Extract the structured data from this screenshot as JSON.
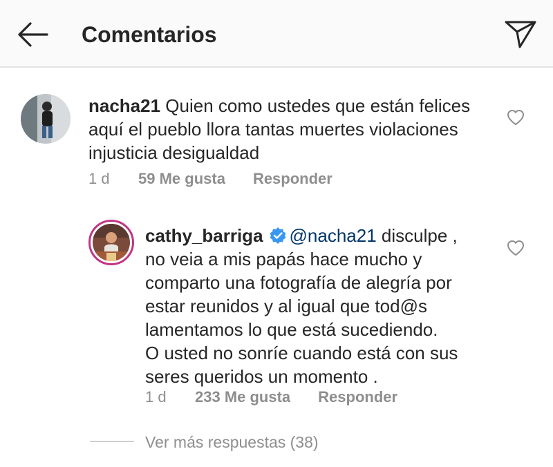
{
  "header": {
    "title": "Comentarios",
    "back_icon": "arrow-left-icon",
    "send_icon": "paper-plane-icon"
  },
  "comment": {
    "username": "nacha21",
    "text_line1": " Quien como ustedes que están felices",
    "text_line2": "aquí el pueblo llora tantas muertes violaciones",
    "text_line3": "injusticia desigualdad",
    "time": "1 d",
    "likes": "59 Me gusta",
    "reply_label": "Responder"
  },
  "reply": {
    "username": "cathy_barriga",
    "verified": true,
    "mention": "@nacha21",
    "lines": [
      " disculpe ,",
      "no veia a mis papás hace mucho y",
      "comparto una fotografía de alegría por",
      "estar reunidos y al igual que tod@s",
      "lamentamos lo que está sucediendo.",
      "O usted no sonríe cuando está con sus",
      "seres queridos un momento ."
    ],
    "time": "1 d",
    "likes": "233 Me gusta",
    "reply_label": "Responder"
  },
  "more_replies": "Ver más respuestas (38)",
  "colors": {
    "text": "#262626",
    "muted": "#8e8e8e",
    "mention": "#003569",
    "verified": "#3897f0",
    "story_ring": "#c13584"
  }
}
